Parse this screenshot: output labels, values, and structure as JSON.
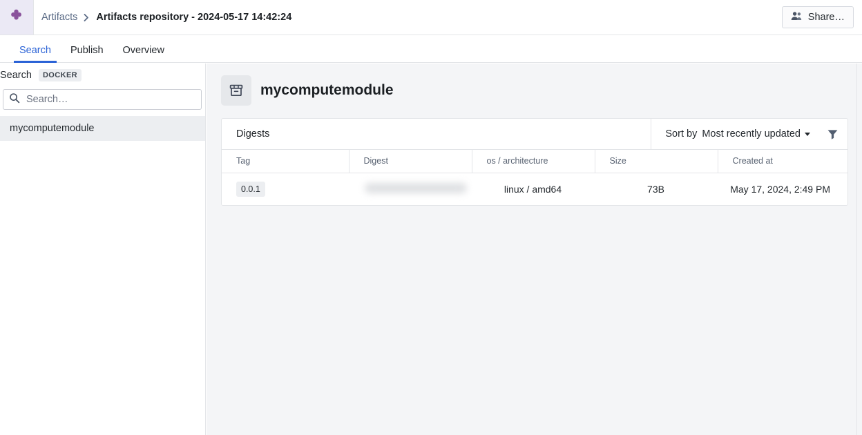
{
  "header": {
    "logo_icon": "puzzle-piece-icon",
    "breadcrumb": {
      "root": "Artifacts",
      "separator": "›",
      "current": "Artifacts repository - 2024-05-17 14:42:24"
    },
    "share_button": {
      "label": "Share…",
      "icon": "users-icon"
    }
  },
  "tabs": [
    {
      "label": "Search",
      "active": true
    },
    {
      "label": "Publish",
      "active": false
    },
    {
      "label": "Overview",
      "active": false
    }
  ],
  "sidebar": {
    "title": "Search",
    "badge": "DOCKER",
    "search": {
      "placeholder": "Search…",
      "value": "",
      "icon": "search-icon"
    },
    "results": [
      {
        "label": "mycomputemodule",
        "selected": true
      }
    ]
  },
  "main": {
    "page_title": "mycomputemodule",
    "page_icon": "package-box-icon",
    "card": {
      "title": "Digests",
      "sort": {
        "label": "Sort by",
        "value": "Most recently updated",
        "caret_icon": "chevron-down-icon"
      },
      "filter_icon": "filter-funnel-icon",
      "columns": [
        "Tag",
        "Digest",
        "os / architecture",
        "Size",
        "Created at"
      ],
      "rows": [
        {
          "tag": "0.0.1",
          "digest": "",
          "digest_redacted": true,
          "os_architecture": "linux / amd64",
          "size": "73B",
          "created_at": "May 17, 2024, 2:49 PM"
        }
      ]
    }
  },
  "colors": {
    "accent_blue": "#2a62d6",
    "logo_purple": "#8a529c",
    "logo_bg": "#ebe9f5",
    "canvas_gray": "#f4f5f7",
    "border_gray": "#e3e5e8",
    "icon_slate": "#525e70"
  }
}
